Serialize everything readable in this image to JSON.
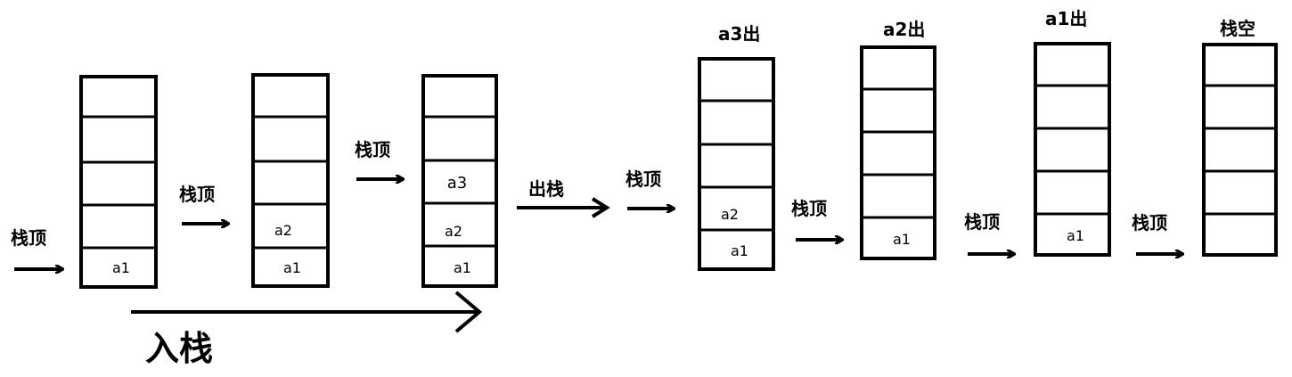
{
  "labels": {
    "top": "栈顶",
    "push": "入栈",
    "pop": "出栈",
    "a3_out": "a3出",
    "a2_out": "a2出",
    "a1_out": "a1出",
    "empty": "栈空"
  },
  "stacks": [
    {
      "cells": [
        "",
        "",
        "",
        "",
        "a1"
      ]
    },
    {
      "cells": [
        "",
        "",
        "",
        "a2",
        "a1"
      ]
    },
    {
      "cells": [
        "",
        "",
        "a3",
        "a2",
        "a1"
      ]
    },
    {
      "cells": [
        "",
        "",
        "",
        "a2",
        "a1"
      ]
    },
    {
      "cells": [
        "",
        "",
        "",
        "",
        "a1"
      ]
    },
    {
      "cells": [
        "",
        "",
        "",
        "",
        "a1"
      ]
    },
    {
      "cells": [
        "",
        "",
        "",
        "",
        ""
      ]
    }
  ]
}
